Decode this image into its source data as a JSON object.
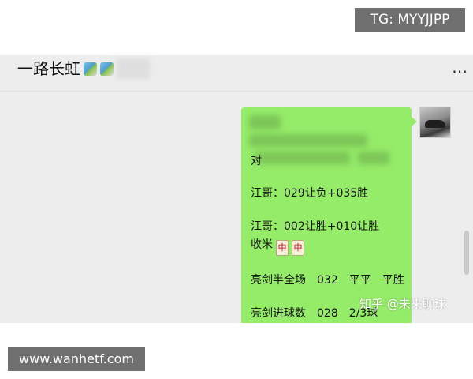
{
  "overlay": {
    "tg_label": "TG: MYYJJPP",
    "site_label": "www.wanhetf.com"
  },
  "header": {
    "title": "一路长虹",
    "title_emojis": [
      "rainbow-emoji",
      "rainbow-emoji"
    ],
    "more_icon": "⋯"
  },
  "message": {
    "bubble_color": "#95ec69",
    "partial_char": "对",
    "lines": [
      "江哥：029让负+035胜",
      "江哥：002让胜+010让胜",
      "收米",
      "亮剑半全场　032　平平　平胜",
      "亮剑进球数　028　2/3球"
    ],
    "mahjong_tiles": [
      "中",
      "中"
    ]
  },
  "watermark": "知乎 @未来聊球",
  "colors": {
    "chat_background": "#ededed",
    "overlay_badge": "#6f6f6f"
  }
}
